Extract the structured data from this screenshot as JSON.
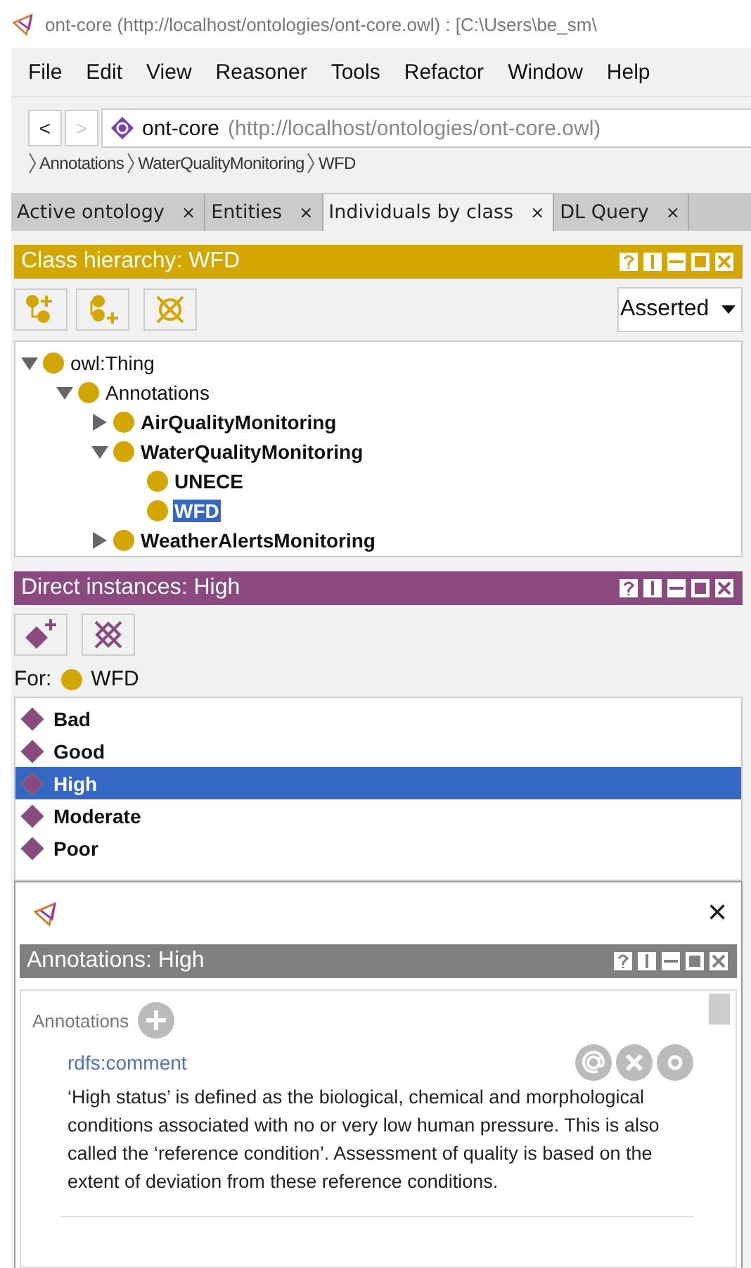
{
  "window": {
    "title": "ont-core (http://localhost/ontologies/ont-core.owl)  : [C:\\Users\\be_sm\\"
  },
  "menu": [
    "File",
    "Edit",
    "View",
    "Reasoner",
    "Tools",
    "Refactor",
    "Window",
    "Help"
  ],
  "nav": {
    "back": "<",
    "forward": ">",
    "forward_disabled": true,
    "ontology_name": "ont-core",
    "ontology_iri": "(http://localhost/ontologies/ont-core.owl)"
  },
  "breadcrumb": [
    "Annotations",
    "WaterQualityMonitoring",
    "WFD"
  ],
  "tabs": [
    {
      "label": "Active ontology",
      "close": "×",
      "selected": false
    },
    {
      "label": "Entities",
      "close": "×",
      "selected": false
    },
    {
      "label": "Individuals by class",
      "close": "×",
      "selected": true
    },
    {
      "label": "DL Query",
      "close": "×",
      "selected": false
    }
  ],
  "class_hierarchy": {
    "title": "Class hierarchy: WFD",
    "mode": "Asserted",
    "tree": [
      {
        "label": "owl:Thing",
        "bold": false,
        "leaf": false,
        "expanded": true,
        "selected": false,
        "children": [
          {
            "label": "Annotations",
            "bold": false,
            "leaf": false,
            "expanded": true,
            "selected": false,
            "children": [
              {
                "label": "AirQualityMonitoring",
                "bold": true,
                "leaf": false,
                "expanded": false,
                "selected": false
              },
              {
                "label": "WaterQualityMonitoring",
                "bold": true,
                "leaf": false,
                "expanded": true,
                "selected": false,
                "children": [
                  {
                    "label": "UNECE",
                    "bold": true,
                    "leaf": true,
                    "expanded": false,
                    "selected": false
                  },
                  {
                    "label": "WFD",
                    "bold": true,
                    "leaf": true,
                    "expanded": false,
                    "selected": true
                  }
                ]
              },
              {
                "label": "WeatherAlertsMonitoring",
                "bold": true,
                "leaf": false,
                "expanded": false,
                "selected": false
              }
            ]
          }
        ]
      }
    ]
  },
  "direct_instances": {
    "title": "Direct instances: High",
    "for_label": "For:",
    "for_class": "WFD",
    "items": [
      {
        "label": "Bad",
        "selected": false
      },
      {
        "label": "Good",
        "selected": false
      },
      {
        "label": "High",
        "selected": true
      },
      {
        "label": "Moderate",
        "selected": false
      },
      {
        "label": "Poor",
        "selected": false
      }
    ]
  },
  "annotations_window": {
    "close": "×",
    "title": "Annotations: High",
    "section": "Annotations",
    "property": "rdfs:comment",
    "comment": "‘High status’ is defined as the biological, chemical and morphological conditions associated with no or very low human pressure. This is also called the ‘reference condition’. Assessment of quality is based on the extent of deviation from these reference conditions."
  }
}
